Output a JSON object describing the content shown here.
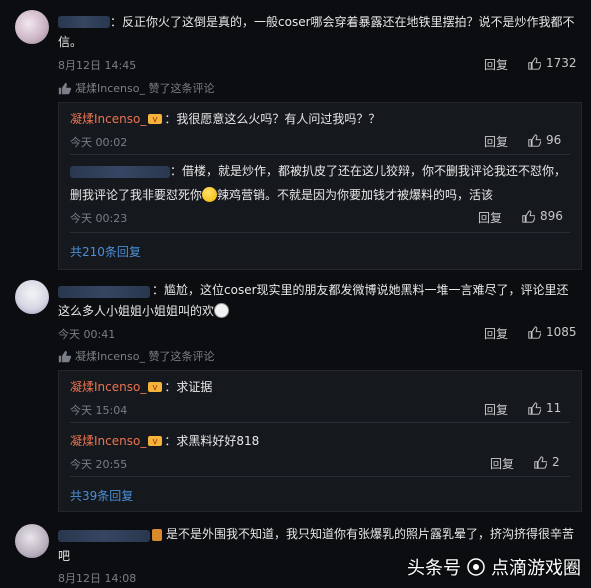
{
  "comments": [
    {
      "text": "：反正你火了这倒是真的，一般coser哪会穿着暴露还在地铁里摆拍？说不是炒作我都不",
      "text2": "信。",
      "time": "8月12日 14:45",
      "reply": "回复",
      "likes": "1732",
      "liked_by": "凝煣Incenso_ 赞了这条评论"
    },
    {
      "text": "：尴尬，这位coser现实里的朋友都发微博说她黑料一堆一言难尽了，评论里还",
      "text2": "这么多人小姐姐小姐姐叫的欢",
      "time": "今天 00:41",
      "reply": "回复",
      "likes": "1085",
      "liked_by": "凝煣Incenso_ 赞了这条评论"
    },
    {
      "text": "是不是外围我不知道，我只知道你有张爆乳的照片露乳晕了，挤沟挤得很辛苦",
      "text2": "吧",
      "time": "8月12日 14:08"
    }
  ],
  "thread1": {
    "replies": [
      {
        "name": "凝煣Incenso_",
        "text": "：我很愿意这么火吗？有人问过我吗？？",
        "time": "今天 00:02",
        "reply": "回复",
        "likes": "96"
      },
      {
        "text": "：借楼，就是炒作，都被扒皮了还在这儿狡辩，你不删我评论我还不怼你，",
        "text2": "删我评论了我非要怼死你",
        "text3": "辣鸡营销。不就是因为你要加钱才被爆料的吗，活该",
        "time": "今天 00:23",
        "reply": "回复",
        "likes": "896"
      }
    ],
    "more": "共210条回复"
  },
  "thread2": {
    "replies": [
      {
        "name": "凝煣Incenso_",
        "text": "：求证据",
        "time": "今天 15:04",
        "reply": "回复",
        "likes": "11"
      },
      {
        "name": "凝煣Incenso_",
        "text": "：求黑料好好818",
        "time": "今天 20:55",
        "reply": "回复",
        "likes": "2"
      }
    ],
    "more": "共39条回复"
  },
  "watermark": {
    "left": "头条号",
    "right": "点滴游戏圈"
  },
  "colors": {
    "background": "#0b0d10",
    "name": "#eb7350",
    "link": "#4a8fd8",
    "meta": "#7a7f87"
  }
}
